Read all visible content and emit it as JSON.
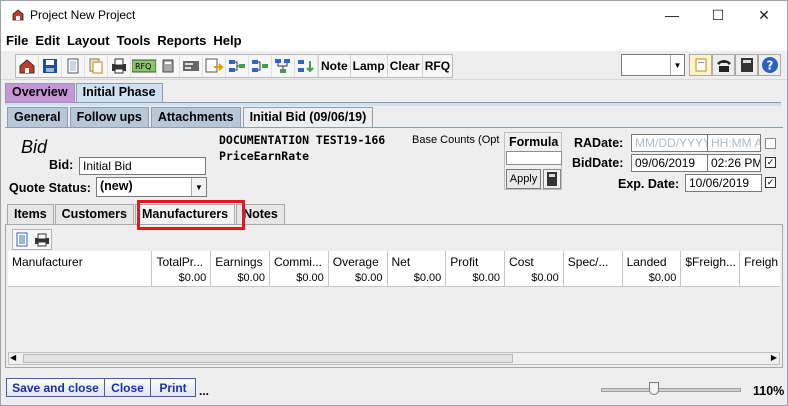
{
  "window": {
    "title": "Project New Project"
  },
  "menu": [
    "File",
    "Edit",
    "Layout",
    "Tools",
    "Reports",
    "Help"
  ],
  "toolbar": {
    "text_buttons": [
      "Note",
      "Lamp",
      "Clear",
      "RFQ"
    ]
  },
  "phase_tabs": [
    "Overview",
    "Initial Phase"
  ],
  "sub_tabs": [
    "General",
    "Follow ups",
    "Attachments",
    "Initial Bid (09/06/19)"
  ],
  "bid": {
    "heading": "Bid",
    "bid_label": "Bid:",
    "bid_value": "Initial Bid",
    "quote_status_label": "Quote Status:",
    "quote_status_value": "(new)",
    "doc_title": "DOCUMENTATION TEST19-166",
    "doc_sub": "PriceEarnRate",
    "base_counts": "Base Counts (Opt",
    "formula_label": "Formula",
    "apply_label": "Apply",
    "radate_label": "RADate:",
    "radate_placeholder": "MM/DD/YYYY",
    "ratime_placeholder": "HH:MM A",
    "biddate_label": "BidDate:",
    "biddate_value": "09/06/2019",
    "bidtime_value": "02:26 PM",
    "expdate_label": "Exp. Date:",
    "expdate_value": "10/06/2019"
  },
  "content_tabs": [
    "Items",
    "Customers",
    "Manufacturers",
    "Notes"
  ],
  "grid": {
    "columns": [
      {
        "header": "Manufacturer",
        "value": ""
      },
      {
        "header": "TotalPr...",
        "value": "$0.00"
      },
      {
        "header": "Earnings",
        "value": "$0.00"
      },
      {
        "header": "Commi...",
        "value": "$0.00"
      },
      {
        "header": "Overage",
        "value": "$0.00"
      },
      {
        "header": "Net",
        "value": "$0.00"
      },
      {
        "header": "Profit",
        "value": "$0.00"
      },
      {
        "header": "Cost",
        "value": "$0.00"
      },
      {
        "header": "Spec/...",
        "value": ""
      },
      {
        "header": "Landed",
        "value": "$0.00"
      },
      {
        "header": "$Freigh...",
        "value": ""
      },
      {
        "header": "Freigh",
        "value": ""
      }
    ]
  },
  "bottom": {
    "save_close": "Save and close",
    "close": "Close",
    "print": "Print",
    "more": "...",
    "zoom": "110%",
    "zoom_level_fraction": 0.38
  },
  "colors": {
    "overview_tab": "#c795d8",
    "phase_tab": "#cfe0f2",
    "highlight": "#e0191e",
    "button_text": "#1a2fa8"
  }
}
